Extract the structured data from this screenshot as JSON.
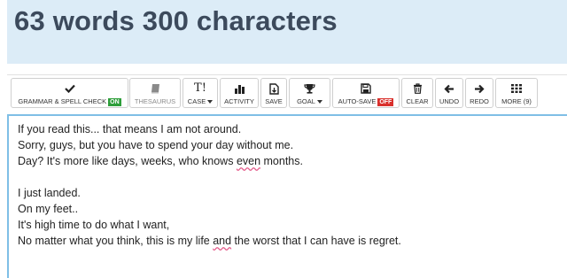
{
  "header": {
    "title": "63 words 300 characters"
  },
  "toolbar": {
    "grammar": {
      "label": "GRAMMAR & SPELL CHECK",
      "badge": "ON",
      "icon": "checkmark-icon"
    },
    "thesaurus": {
      "label": "THESAURUS",
      "icon": "book-icon"
    },
    "case": {
      "label": "CASE",
      "icon": "text-case-icon",
      "glyph": "T!"
    },
    "activity": {
      "label": "ACTIVITY",
      "icon": "bar-chart-icon"
    },
    "save": {
      "label": "SAVE",
      "icon": "file-download-icon"
    },
    "goal": {
      "label": "GOAL",
      "icon": "trophy-icon"
    },
    "autosave": {
      "label": "AUTO-SAVE",
      "badge": "OFF",
      "icon": "floppy-disk-icon"
    },
    "clear": {
      "label": "CLEAR",
      "icon": "trash-icon"
    },
    "undo": {
      "label": "UNDO",
      "icon": "arrow-left-icon"
    },
    "redo": {
      "label": "REDO",
      "icon": "arrow-right-icon"
    },
    "more": {
      "label": "MORE (9)",
      "icon": "grid-icon"
    }
  },
  "editor": {
    "lines": [
      {
        "text": "If you read this... that means I am not around."
      },
      {
        "text": "Sorry, guys, but you have to spend your day without me."
      },
      {
        "pre": "Day? It's more like days, weeks, who knows ",
        "flag": "even",
        "post": " months."
      },
      {
        "text": ""
      },
      {
        "text": "I just landed."
      },
      {
        "text": "On my feet.."
      },
      {
        "text": "It's high time to do what I want,"
      },
      {
        "pre": "No matter what you think, this is my life ",
        "flag": "and",
        "post": " the worst that I can have is regret."
      }
    ]
  },
  "colors": {
    "header_bg": "#dcecf7",
    "title": "#3c4a5c",
    "badge_on": "#2e9e3a",
    "badge_off": "#d9302c",
    "editor_border": "#7fbfe6",
    "spell_underline": "#e45a8a"
  }
}
